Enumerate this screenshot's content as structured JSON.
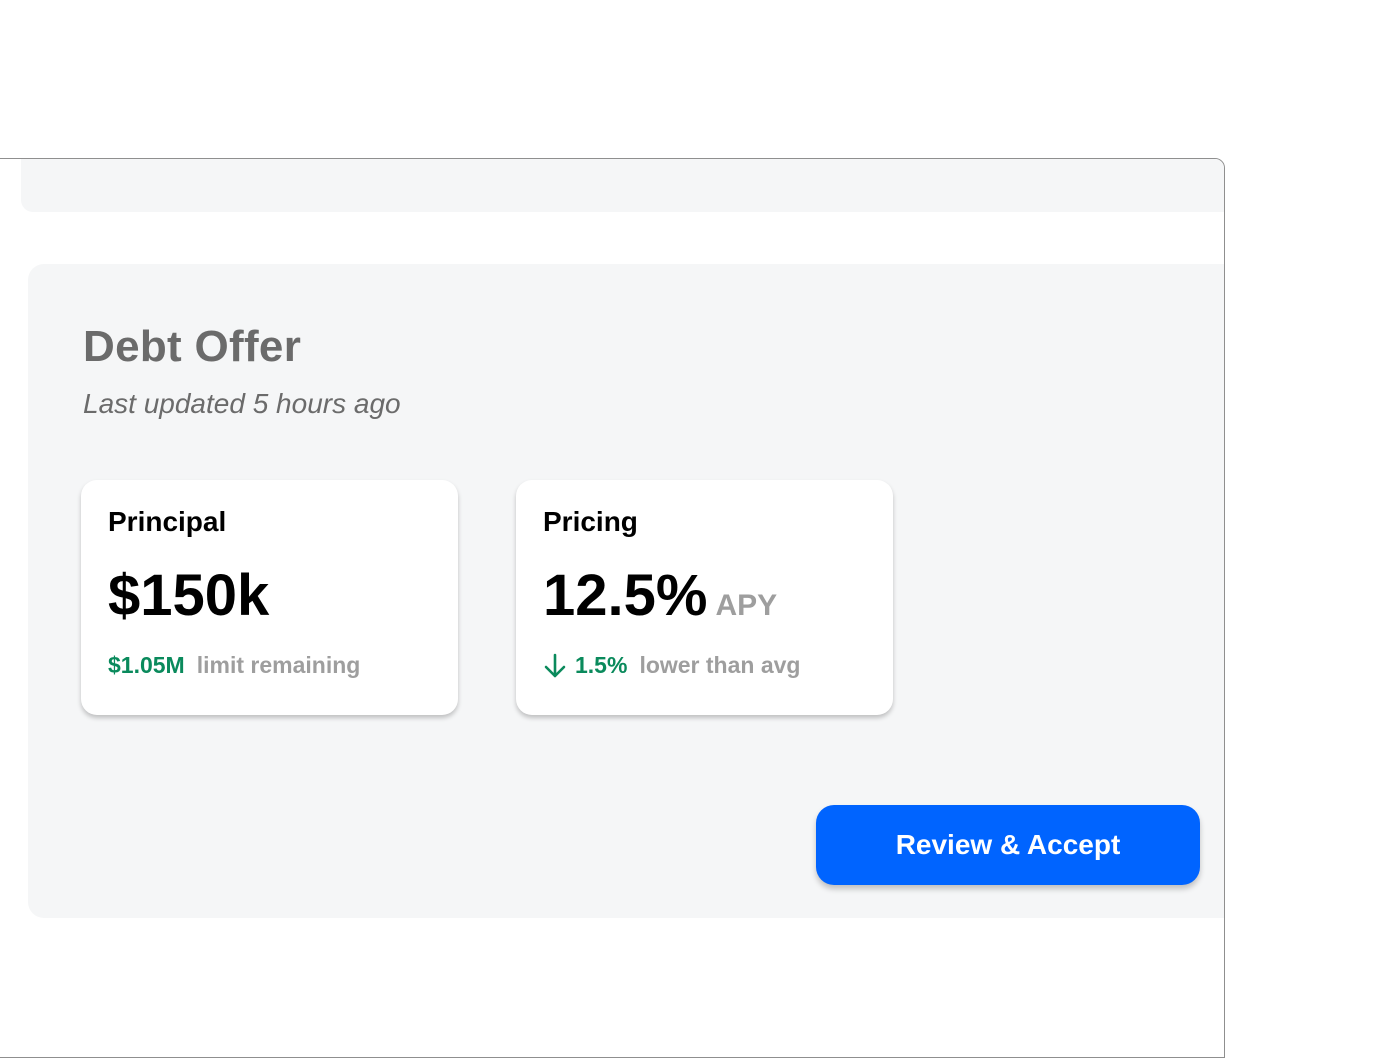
{
  "offer": {
    "title": "Debt Offer",
    "subtitle": "Last updated 5 hours ago"
  },
  "principal_card": {
    "label": "Principal",
    "value": "$150k",
    "highlight": "$1.05M",
    "note": "limit remaining"
  },
  "pricing_card": {
    "label": "Pricing",
    "value": "12.5%",
    "unit": "APY",
    "trend_icon": "arrow-down-icon",
    "highlight": "1.5%",
    "note": "lower than avg"
  },
  "actions": {
    "primary_label": "Review & Accept"
  },
  "colors": {
    "primary": "#0064ff",
    "positive": "#0a8a5c",
    "muted": "#9e9e9e",
    "panel_bg": "#f5f6f7"
  }
}
